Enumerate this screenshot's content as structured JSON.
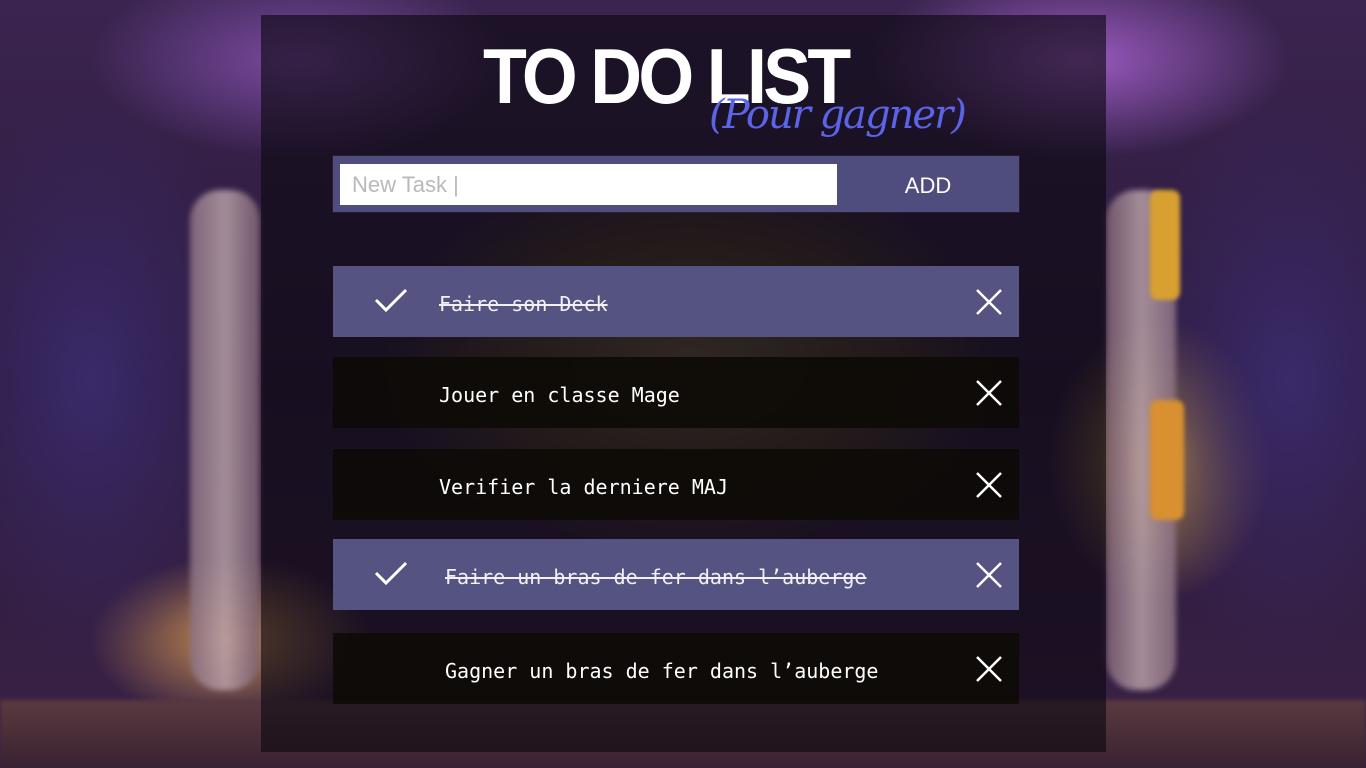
{
  "header": {
    "title": "TO DO LIST",
    "subtitle": "(Pour gagner)"
  },
  "new_task": {
    "placeholder": "New Task |",
    "value": "",
    "add_label": "ADD"
  },
  "tasks": [
    {
      "label": "Faire son Deck",
      "done": true
    },
    {
      "label": "Jouer en classe Mage",
      "done": false
    },
    {
      "label": "Verifier la derniere MAJ",
      "done": false
    },
    {
      "label": "Faire un bras de fer dans l’auberge",
      "done": true
    },
    {
      "label": "Gagner un bras de fer dans l’auberge",
      "done": false
    }
  ],
  "icons": {
    "check": "check-icon",
    "delete": "close-icon"
  },
  "colors": {
    "done_row": "#545381",
    "todo_row": "#0c0a06",
    "input_bar": "#4e4d7d",
    "subtitle": "#5b63e6",
    "text": "#ffffff"
  }
}
